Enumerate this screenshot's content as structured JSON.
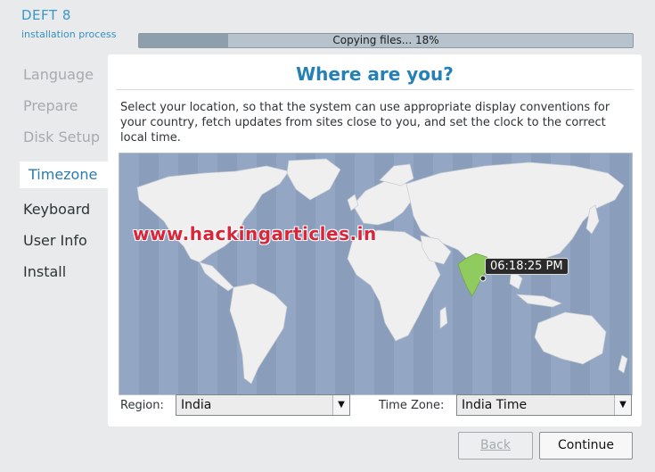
{
  "brand": {
    "title": "DEFT 8",
    "subtitle": "installation process"
  },
  "progress": {
    "label": "Copying files... 18%",
    "percent": 18
  },
  "nav": {
    "items": [
      {
        "label": "Language",
        "state": "done"
      },
      {
        "label": "Prepare",
        "state": "done"
      },
      {
        "label": "Disk Setup",
        "state": "done"
      },
      {
        "label": "Timezone",
        "state": "active"
      },
      {
        "label": "Keyboard",
        "state": "pending"
      },
      {
        "label": "User Info",
        "state": "pending"
      },
      {
        "label": "Install",
        "state": "pending"
      }
    ]
  },
  "panel": {
    "title": "Where are you?",
    "description": "Select your location, so that the system can use appropriate display conventions for your country, fetch updates from sites close to you, and set the clock to the correct local time."
  },
  "map": {
    "watermark": "www.hackingarticles.in",
    "time": "06:18:25 PM",
    "colors": {
      "ocean": "#93a6c4",
      "land": "#efefef",
      "selected": "#8fcb5f",
      "tz_band": "#8a9dbb"
    }
  },
  "region": {
    "label": "Region:",
    "value": "India"
  },
  "timezone": {
    "label": "Time Zone:",
    "value": "India Time"
  },
  "buttons": {
    "back": "Back",
    "continue": "Continue"
  }
}
